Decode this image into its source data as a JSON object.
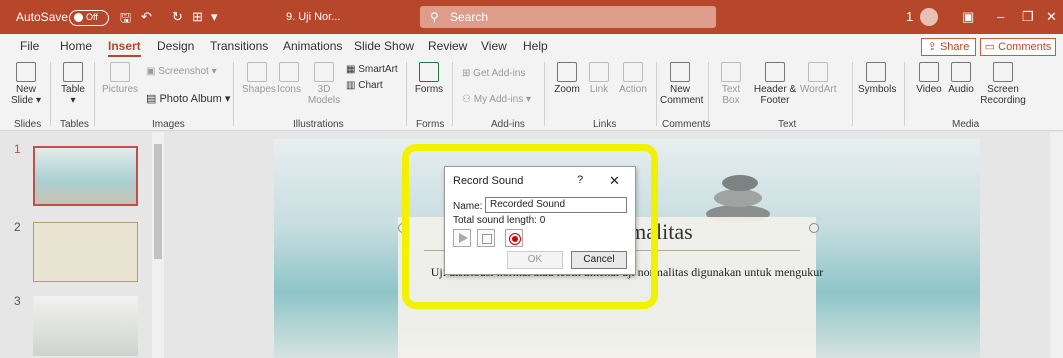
{
  "titlebar": {
    "autosave_label": "AutoSave",
    "autosave_state": "Off",
    "file_name": "9. Uji Nor...",
    "search_placeholder": "Search",
    "account_number": "1"
  },
  "tabs": [
    "File",
    "Home",
    "Insert",
    "Design",
    "Transitions",
    "Animations",
    "Slide Show",
    "Review",
    "View",
    "Help"
  ],
  "active_tab": "Insert",
  "share_label": "Share",
  "comments_label": "Comments",
  "ribbon": {
    "new_slide": "New Slide",
    "table": "Table",
    "pictures": "Pictures",
    "screenshot": "Screenshot",
    "photo_album": "Photo Album",
    "shapes": "Shapes",
    "icons": "Icons",
    "models_3d": "3D Models",
    "smartart": "SmartArt",
    "chart": "Chart",
    "forms": "Forms",
    "get_addins": "Get Add-ins",
    "my_addins": "My Add-ins",
    "zoom": "Zoom",
    "link": "Link",
    "action": "Action",
    "new_comment": "New Comment",
    "text_box": "Text Box",
    "header_footer": "Header & Footer",
    "wordart": "WordArt",
    "symbols": "Symbols",
    "video": "Video",
    "audio": "Audio",
    "screen_recording": "Screen Recording",
    "groups": [
      "Slides",
      "Tables",
      "Images",
      "Illustrations",
      "Forms",
      "Add-ins",
      "Links",
      "Comments",
      "Text",
      "Media"
    ]
  },
  "thumbnails": [
    {
      "num": "1"
    },
    {
      "num": "2"
    },
    {
      "num": "3"
    }
  ],
  "slide": {
    "title": "Uji Normalitas",
    "body": "Uji distribusi normal atau lebih dikenal uji normalitas digunakan untuk mengukur"
  },
  "dialog": {
    "title": "Record Sound",
    "help": "?",
    "close": "✕",
    "name_label": "Name:",
    "name_value": "Recorded Sound",
    "length_label": "Total sound length:",
    "length_value": "0",
    "ok_label": "OK",
    "cancel_label": "Cancel"
  },
  "colors": {
    "accent": "#b7472a",
    "highlight": "#f2f200"
  }
}
